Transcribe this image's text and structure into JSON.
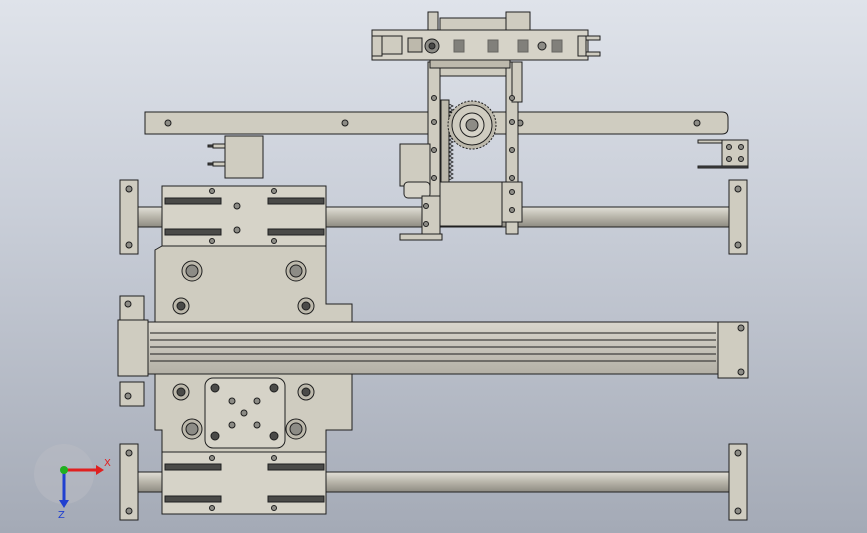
{
  "triad": {
    "x_label": "X",
    "z_label": "Z"
  },
  "colors": {
    "background_top": "#dfe3ea",
    "background_bottom": "#a4aab6",
    "part_fill": "#cfccc0",
    "part_fill_dark": "#bdb9ac",
    "edge": "#1f1f1f",
    "hole": "#8d8c86",
    "slot": "#4a4a48",
    "axis_x": "#e02020",
    "axis_y": "#20b020",
    "axis_z": "#2040d0"
  }
}
